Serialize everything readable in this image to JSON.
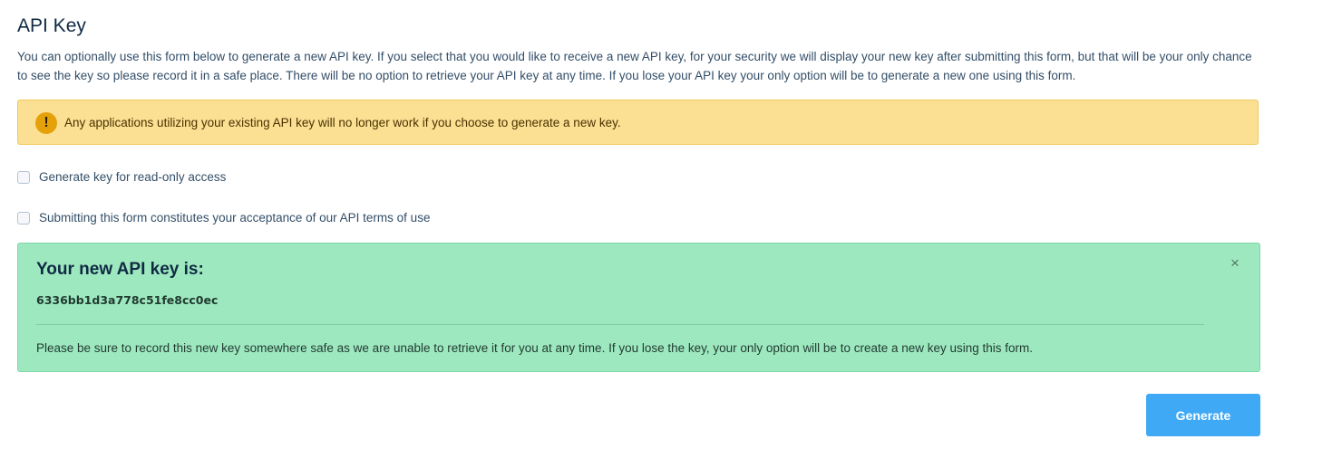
{
  "page": {
    "title": "API Key",
    "intro": "You can optionally use this form below to generate a new API key. If you select that you would like to receive a new API key, for your security we will display your new key after submitting this form, but that will be your only chance to see the key so please record it in a safe place. There will be no option to retrieve your API key at any time. If you lose your API key your only option will be to generate a new one using this form."
  },
  "warning": {
    "icon": "exclamation-icon",
    "text": "Any applications utilizing your existing API key will no longer work if you choose to generate a new key."
  },
  "options": {
    "read_only_label": "Generate key for read-only access",
    "read_only_checked": false,
    "terms_label": "Submitting this form constitutes your acceptance of our API terms of use",
    "terms_checked": false
  },
  "result": {
    "title": "Your new API key is:",
    "key": "6336bb1d3a778c51fe8cc0ec",
    "note": "Please be sure to record this new key somewhere safe as we are unable to retrieve it for you at any time. If you lose the key, your only option will be to create a new key using this form.",
    "close_symbol": "×"
  },
  "actions": {
    "generate_label": "Generate"
  },
  "colors": {
    "warning_bg": "#fbdf93",
    "success_bg": "#9ee8c0",
    "primary": "#3fa9f5"
  }
}
